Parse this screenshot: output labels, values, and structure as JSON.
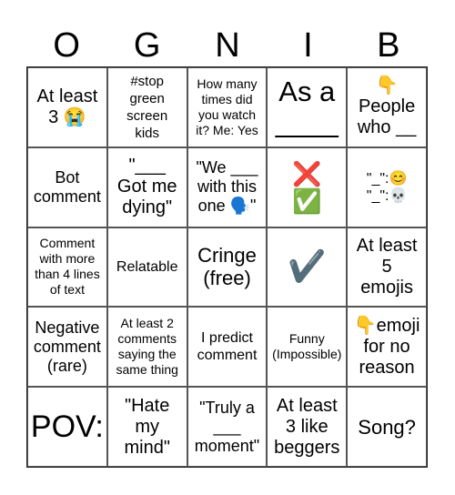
{
  "header": [
    "O",
    "G",
    "N",
    "I",
    "B"
  ],
  "cells": [
    "At least\n3 😭",
    "#stop\ngreen\nscreen\nkids",
    "How many\ntimes did\nyou watch\nit? Me: Yes",
    "As a\n____",
    "👇\nPeople\nwho __",
    "Bot\ncomment",
    "\"___\nGot me\ndying\"",
    "\"We ___\nwith this\none 🗣️\"",
    "❌\n✅",
    "\"_\":😊\n\"_\":💀",
    "Comment\nwith more\nthan 4 lines\nof text",
    "Relatable",
    "Cringe\n(free)",
    "✔️",
    "At least\n5\nemojis",
    "Negative\ncomment\n(rare)",
    "At least 2\ncomments\nsaying the\nsame thing",
    "I predict\ncomment",
    "Funny\n(Impossible)",
    "👇emoji\nfor no\nreason",
    "POV:",
    "\"Hate\nmy\nmind\"",
    "\"Truly a\n___\nmoment\"",
    "At least\n3 like\nbeggers",
    "Song?"
  ]
}
